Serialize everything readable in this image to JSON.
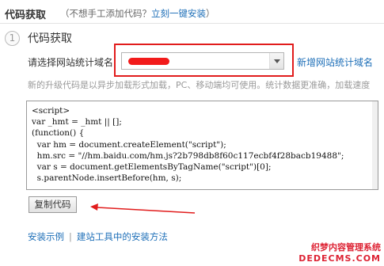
{
  "header": {
    "title": "代码获取",
    "subtitle_prefix": "（不想手工添加代码？",
    "install_link": "立刻一键安装",
    "subtitle_suffix": "）"
  },
  "step": {
    "number": "1",
    "title": "代码获取"
  },
  "domain_select": {
    "label": "请选择网站统计域名",
    "selected_value": "[redacted]",
    "new_domain_link": "新增网站统计域名"
  },
  "notice": "新的升级代码是以异步加载形式加载，PC、移动端均可使用。统计数据更准确，加载速度",
  "code_lines": [
    "<script>",
    "var _hmt = _hmt || [];",
    "(function() {",
    "  var hm = document.createElement(\"script\");",
    "  hm.src = \"//hm.baidu.com/hm.js?2b798db8f60c117ecbf4f28bacb19488\";",
    "  var s = document.getElementsByTagName(\"script\")[0];",
    "  s.parentNode.insertBefore(hm, s);"
  ],
  "copy_button_label": "复制代码",
  "footer": {
    "example_link": "安装示例",
    "separator": "|",
    "tool_link": "建站工具中的安装方法"
  },
  "watermark": {
    "cn": "织梦内容管理系统",
    "en": "DEDECMS.COM"
  },
  "colors": {
    "link": "#1e6fb8",
    "annotation_red": "#e11c1c"
  }
}
